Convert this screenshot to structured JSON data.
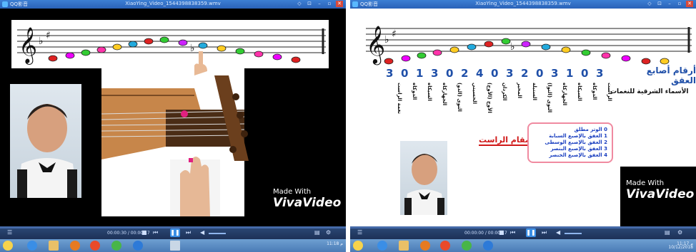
{
  "player": {
    "app_name": "QQ影音",
    "window_title": "XiaoYing_Video_1544398838359.wmv",
    "window_buttons": [
      "◇",
      "⊡",
      "–",
      "▫",
      "✕"
    ]
  },
  "left": {
    "time": "00:00:30 / 00:00:17",
    "watermark_line1": "Made With",
    "watermark_line2": "VivaVideo",
    "tray_time": "11:18 م"
  },
  "right": {
    "time": "00:00:00 / 00:00:17",
    "watermark_line1": "Made With",
    "watermark_line2": "VivaVideo",
    "tray_time": "11:17 م",
    "tray_date": "10/12/2018",
    "heading": "أرقام أصابع العقق",
    "subheading": "الأسماء الشرقية للنغمات",
    "finger_numbers": [
      "3",
      "0",
      "1",
      "3",
      "0",
      "2",
      "4",
      "0",
      "3",
      "2",
      "0",
      "3",
      "1",
      "0",
      "3"
    ],
    "note_names": [
      "نغمة الراست",
      "الدوكاه",
      "السيكاه",
      "الجهاركاه",
      "النوى (الدو)",
      "الحسيني",
      "الأوج (الأوج)",
      "الكردان",
      "المحير",
      "السنبلة",
      "النوى (النوا)",
      "الجهاركاه",
      "السيكاه",
      "الدوكاه",
      "الراست"
    ],
    "maqam_label": "مقام الراست",
    "legend": [
      "0 الوتر مطلق",
      "1 العفق بالإصبع السبابة",
      "2 العفق بالإصبع الوسطى",
      "3 العفق بالإصبع البنصر",
      "4 العفق بالإصبع الخنصر"
    ]
  },
  "colors": {
    "titlebar": "#2a62b8",
    "heading_blue": "#1f4fa8",
    "maqam_red": "#d01818",
    "legend_border": "#f08aa0"
  }
}
